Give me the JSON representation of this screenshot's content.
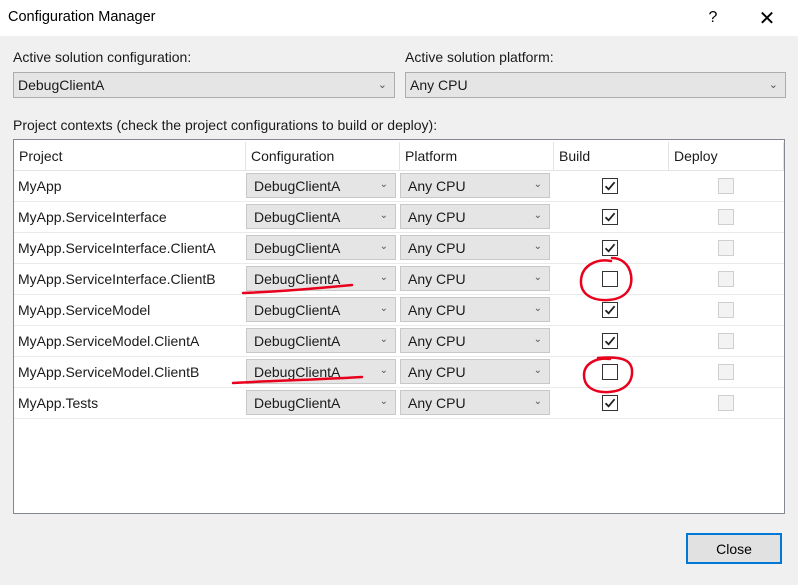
{
  "window": {
    "title": "Configuration Manager",
    "help_icon": "?",
    "close_icon": "✕"
  },
  "solution_config": {
    "label": "Active solution configuration:",
    "value": "DebugClientA"
  },
  "solution_platform": {
    "label": "Active solution platform:",
    "value": "Any CPU"
  },
  "contexts_label": "Project contexts (check the project configurations to build or deploy):",
  "columns": [
    "Project",
    "Configuration",
    "Platform",
    "Build",
    "Deploy"
  ],
  "rows": [
    {
      "project": "MyApp",
      "configuration": "DebugClientA",
      "platform": "Any CPU",
      "build": true,
      "deploy": false
    },
    {
      "project": "MyApp.ServiceInterface",
      "configuration": "DebugClientA",
      "platform": "Any CPU",
      "build": true,
      "deploy": false
    },
    {
      "project": "MyApp.ServiceInterface.ClientA",
      "configuration": "DebugClientA",
      "platform": "Any CPU",
      "build": true,
      "deploy": false
    },
    {
      "project": "MyApp.ServiceInterface.ClientB",
      "configuration": "DebugClientA",
      "platform": "Any CPU",
      "build": false,
      "deploy": false
    },
    {
      "project": "MyApp.ServiceModel",
      "configuration": "DebugClientA",
      "platform": "Any CPU",
      "build": true,
      "deploy": false
    },
    {
      "project": "MyApp.ServiceModel.ClientA",
      "configuration": "DebugClientA",
      "platform": "Any CPU",
      "build": true,
      "deploy": false
    },
    {
      "project": "MyApp.ServiceModel.ClientB",
      "configuration": "DebugClientA",
      "platform": "Any CPU",
      "build": false,
      "deploy": false
    },
    {
      "project": "MyApp.Tests",
      "configuration": "DebugClientA",
      "platform": "Any CPU",
      "build": true,
      "deploy": false
    }
  ],
  "close_button": "Close",
  "accent_color": "#0078d7",
  "annotation_color": "#e8001c"
}
